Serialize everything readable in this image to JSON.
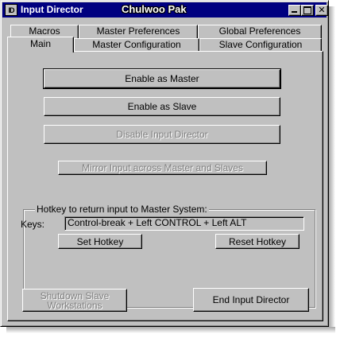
{
  "window": {
    "icon_text": "ID",
    "title": "Input Director",
    "user": "Chulwoo Pak"
  },
  "tabs": {
    "back_row": [
      {
        "label": "Macros"
      },
      {
        "label": "Master Preferences"
      },
      {
        "label": "Global Preferences"
      }
    ],
    "front_row": [
      {
        "label": "Main",
        "active": true
      },
      {
        "label": "Master Configuration"
      },
      {
        "label": "Slave Configuration"
      }
    ]
  },
  "main": {
    "enable_master_label": "Enable as Master",
    "enable_slave_label": "Enable as Slave",
    "disable_label": "Disable Input Director",
    "mirror_label": "Mirror Input across Master and Slaves",
    "hotkey": {
      "group_title": "Hotkey to return input to Master System:",
      "keys_label": "Keys:",
      "keys_value": "Control-break + Left CONTROL + Left ALT",
      "set_label": "Set Hotkey",
      "reset_label": "Reset Hotkey"
    },
    "shutdown_line1": "Shutdown Slave",
    "shutdown_line2": "Workstations",
    "end_label": "End Input Director"
  }
}
